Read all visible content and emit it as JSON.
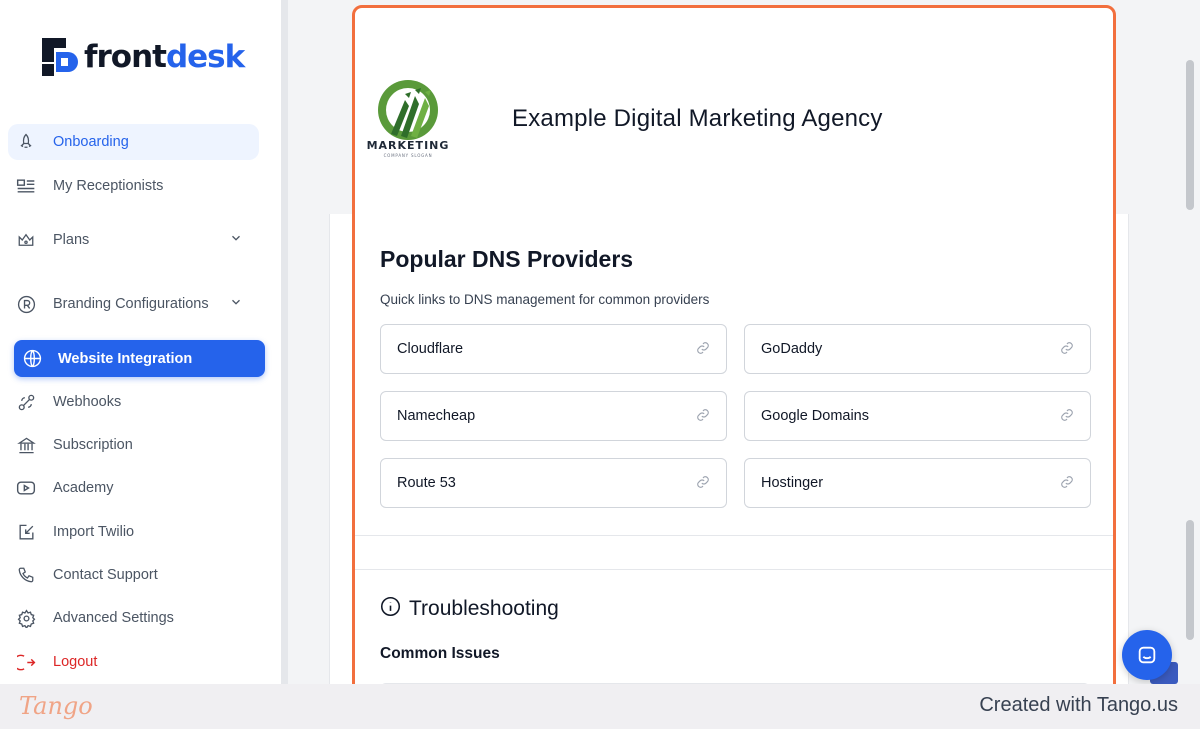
{
  "brand": {
    "name_part1": "front",
    "name_part2": "desk"
  },
  "sidebar": {
    "items": [
      {
        "label": "Onboarding",
        "icon": "rocket-icon"
      },
      {
        "label": "My Receptionists",
        "icon": "list-icon"
      },
      {
        "label": "Plans",
        "icon": "crown-icon"
      },
      {
        "label": "Branding Configurations",
        "icon": "registered-icon"
      },
      {
        "label": "Website Integration",
        "icon": "globe-icon"
      },
      {
        "label": "Webhooks",
        "icon": "webhook-icon"
      },
      {
        "label": "Subscription",
        "icon": "bank-icon"
      },
      {
        "label": "Academy",
        "icon": "play-icon"
      },
      {
        "label": "Import Twilio",
        "icon": "import-icon"
      },
      {
        "label": "Contact Support",
        "icon": "phone-icon"
      },
      {
        "label": "Advanced Settings",
        "icon": "gear-icon"
      },
      {
        "label": "Logout",
        "icon": "logout-icon"
      }
    ]
  },
  "agency": {
    "title": "Example Digital Marketing Agency",
    "logo_text": "MARKETING",
    "logo_slogan": "COMPANY SLOGAN"
  },
  "dns": {
    "title": "Popular DNS Providers",
    "subtitle": "Quick links to DNS management for common providers",
    "providers": [
      "Cloudflare",
      "GoDaddy",
      "Namecheap",
      "Google Domains",
      "Route 53",
      "Hostinger"
    ]
  },
  "troubleshooting": {
    "title": "Troubleshooting",
    "common_issues": "Common Issues"
  },
  "footer": {
    "tango": "Tango",
    "created_with": "Created with Tango.us"
  },
  "colors": {
    "accent": "#2563eb",
    "highlight_border": "#f26f3e",
    "logout": "#dc2626"
  }
}
